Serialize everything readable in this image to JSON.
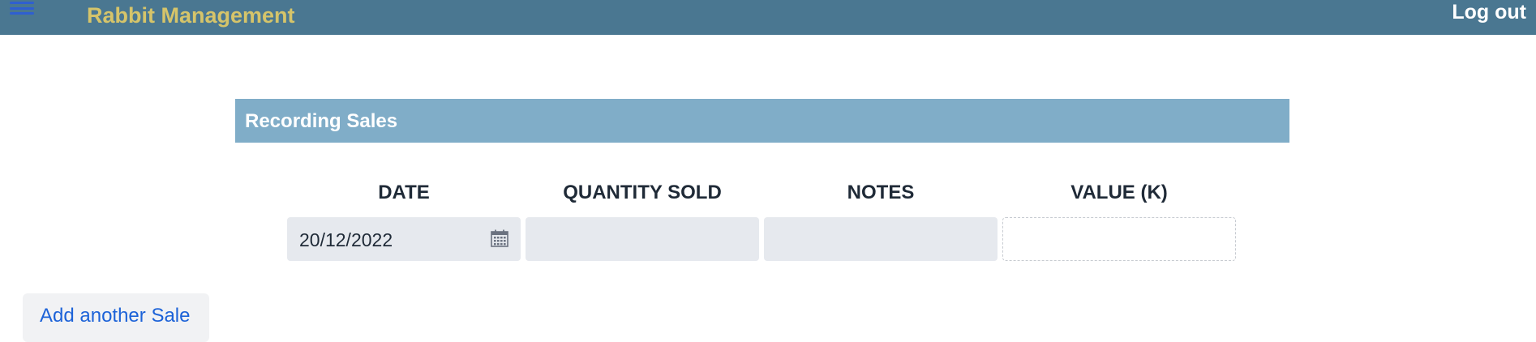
{
  "header": {
    "app_title": "Rabbit Management",
    "logout_label": "Log out",
    "menu_icon": "hamburger-menu-icon"
  },
  "section": {
    "title": "Recording Sales"
  },
  "form": {
    "columns": [
      "DATE",
      "QUANTITY SOLD",
      "NOTES",
      "VALUE (K)"
    ],
    "date_value": "20/12/2022",
    "quantity_value": "",
    "notes_value": "",
    "value_k_value": "",
    "date_icon": "calendar-icon"
  },
  "actions": {
    "add_label": "Add another Sale"
  },
  "colors": {
    "topbar": "#4a7791",
    "title": "#d5c46a",
    "section_header": "#80adc8",
    "link": "#1d63d8"
  }
}
